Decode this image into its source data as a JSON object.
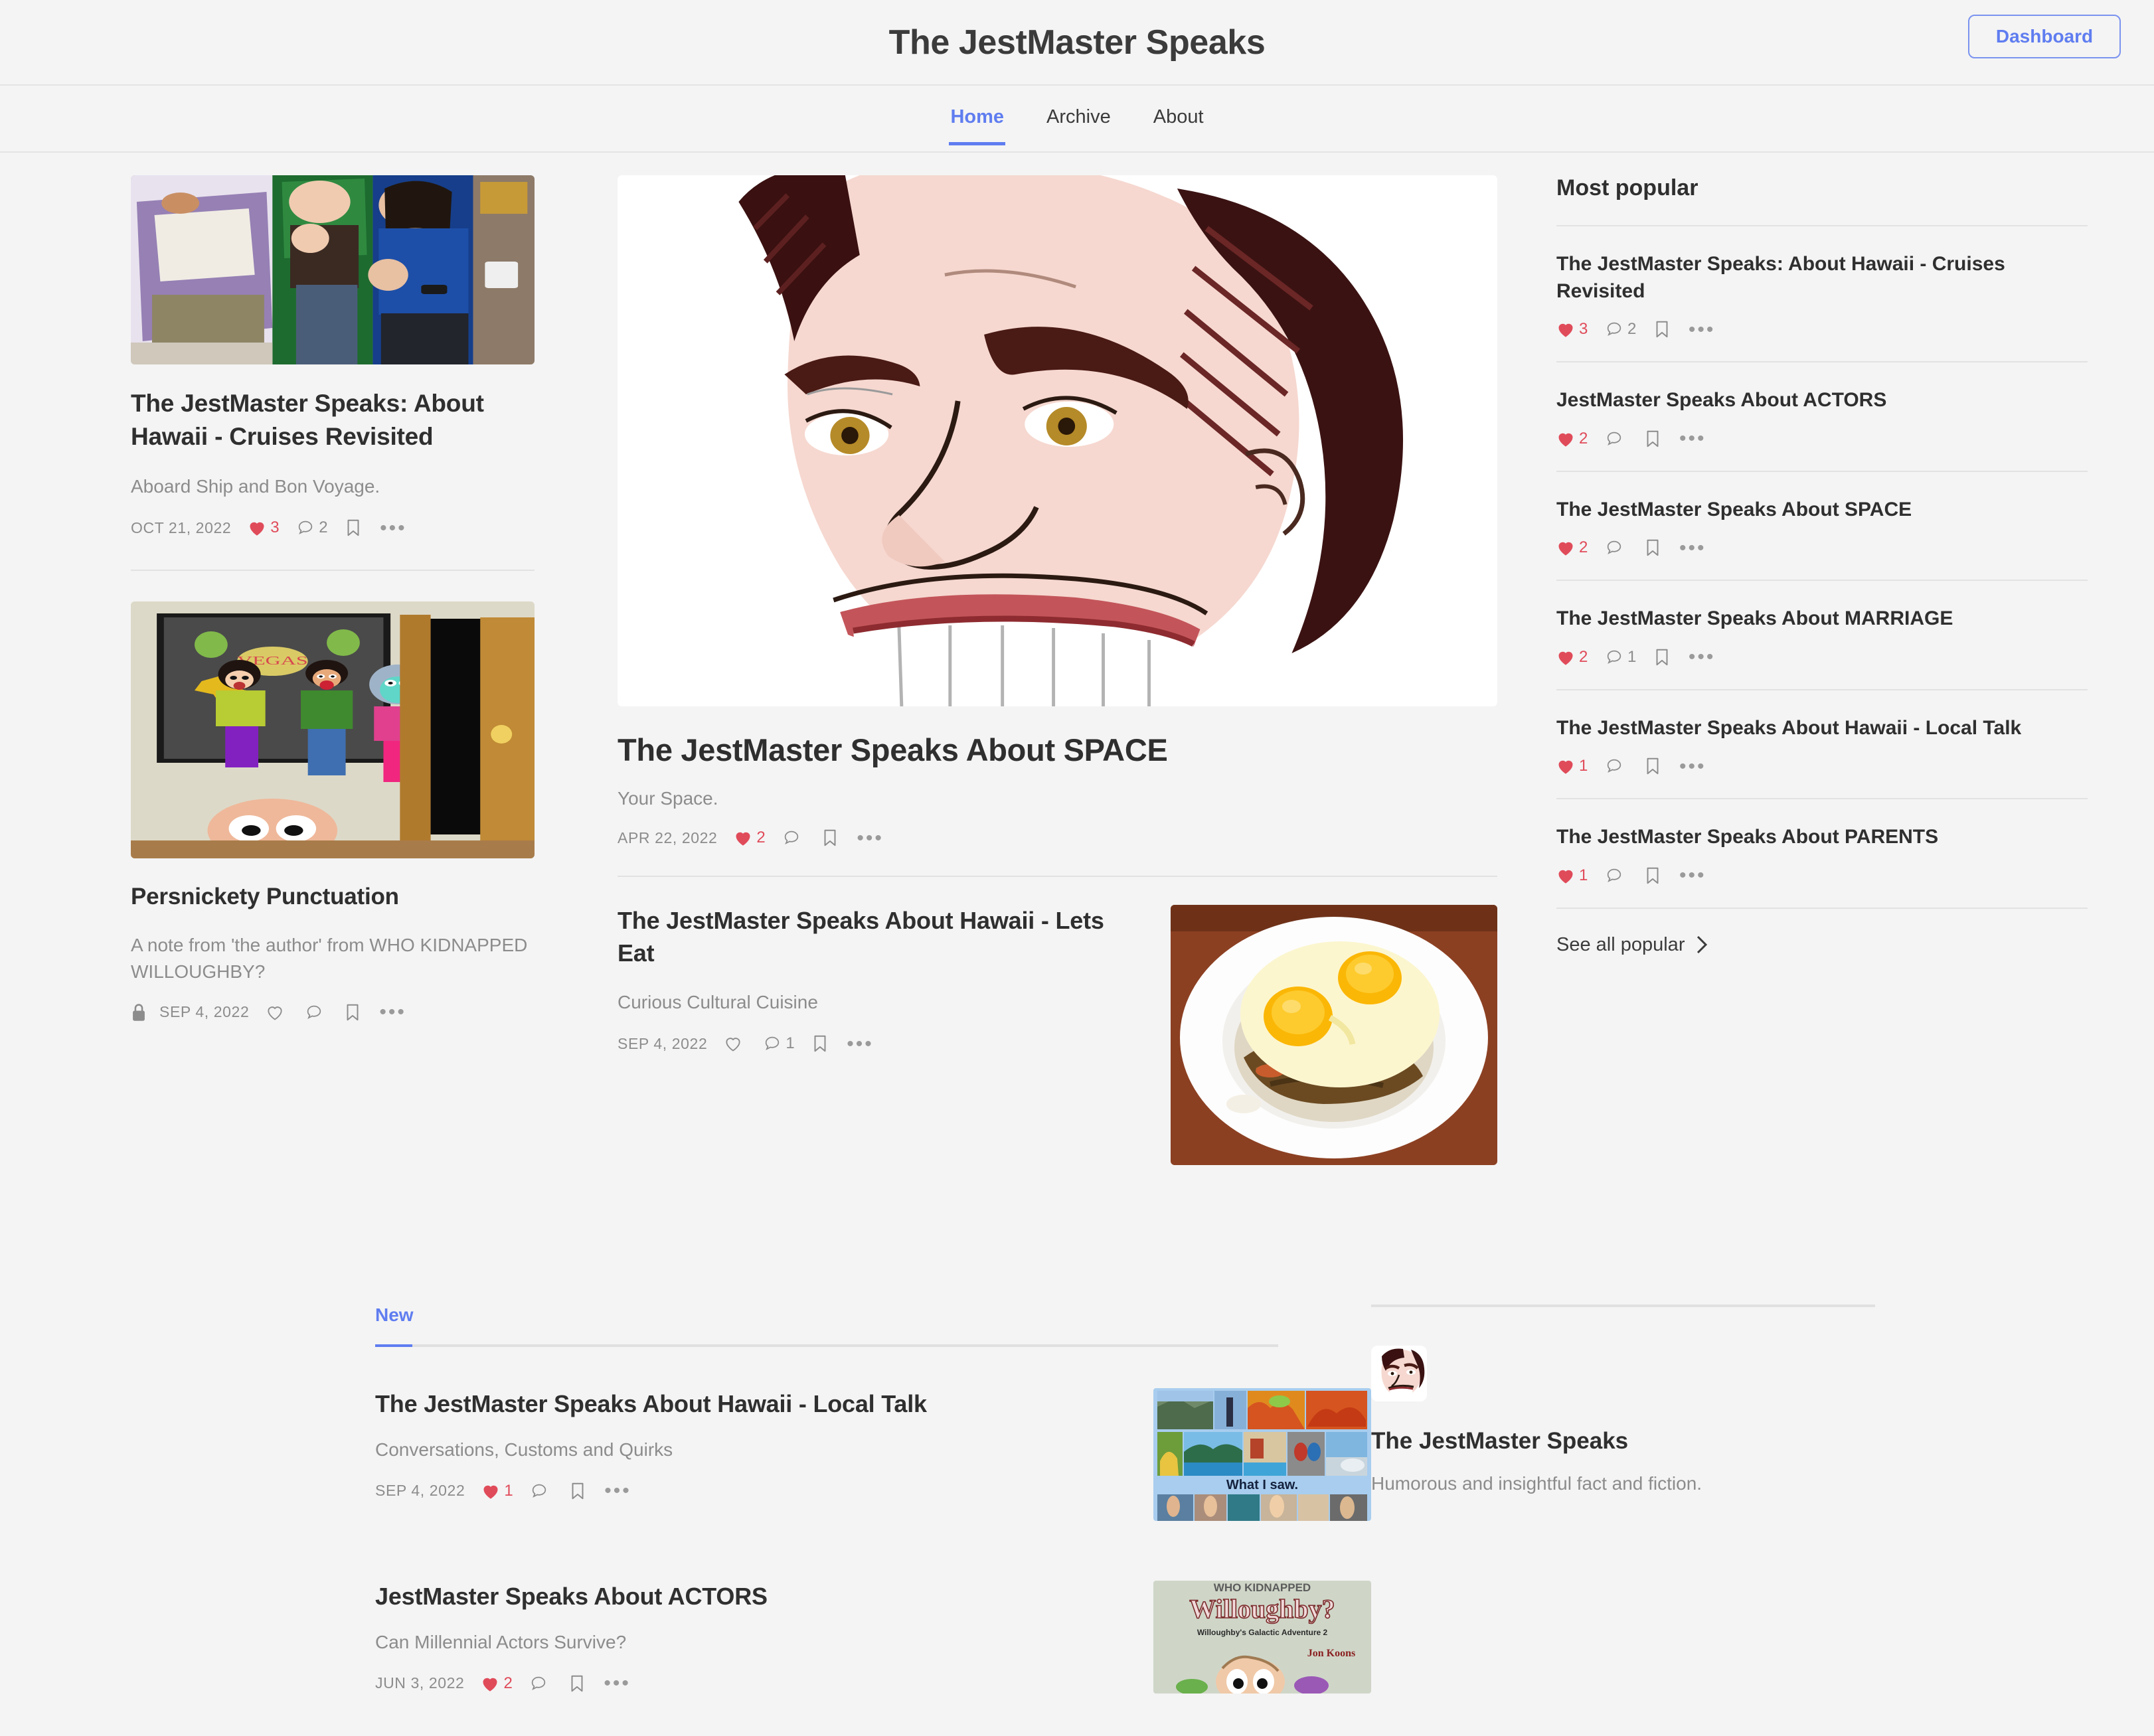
{
  "header": {
    "site_title": "The JestMaster Speaks",
    "dashboard_label": "Dashboard"
  },
  "nav": {
    "items": [
      {
        "label": "Home",
        "active": true
      },
      {
        "label": "Archive",
        "active": false
      },
      {
        "label": "About",
        "active": false
      }
    ]
  },
  "left_column": {
    "cards": [
      {
        "image_alt": "three-people-shaka-hands-photo",
        "title": "The JestMaster Speaks: About Hawaii - Cruises Revisited",
        "subtitle": "Aboard Ship and Bon Voyage.",
        "date": "OCT 21, 2022",
        "likes": "3",
        "comments": "2",
        "locked": false
      },
      {
        "image_alt": "cartoon-las-vegas-doorway-illustration",
        "title": "Persnickety Punctuation",
        "subtitle": "A note from 'the author' from WHO KIDNAPPED WILLOUGHBY?",
        "date": "SEP 4, 2022",
        "likes": "",
        "comments": "",
        "locked": true
      }
    ]
  },
  "middle_column": {
    "featured": {
      "image_alt": "caricature-smiling-man-face",
      "title": "The JestMaster Speaks About SPACE",
      "subtitle": "Your Space.",
      "date": "APR 22, 2022",
      "likes": "2",
      "comments": ""
    },
    "secondary": {
      "title": "The JestMaster Speaks About Hawaii - Lets Eat",
      "subtitle": "Curious Cultural Cuisine",
      "date": "SEP 4, 2022",
      "likes": "",
      "comments": "1",
      "image_alt": "loco-moco-plate-two-fried-eggs"
    }
  },
  "sidebar": {
    "heading": "Most popular",
    "see_all_label": "See all popular",
    "items": [
      {
        "title": "The JestMaster Speaks: About Hawaii - Cruises Revisited",
        "likes": "3",
        "comments": "2"
      },
      {
        "title": "JestMaster Speaks About ACTORS",
        "likes": "2",
        "comments": ""
      },
      {
        "title": "The JestMaster Speaks About SPACE",
        "likes": "2",
        "comments": ""
      },
      {
        "title": "The JestMaster Speaks About MARRIAGE",
        "likes": "2",
        "comments": "1"
      },
      {
        "title": "The JestMaster Speaks About Hawaii - Local Talk",
        "likes": "1",
        "comments": ""
      },
      {
        "title": "The JestMaster Speaks About PARENTS",
        "likes": "1",
        "comments": ""
      }
    ]
  },
  "bottom": {
    "tab_label": "New",
    "posts": [
      {
        "title": "The JestMaster Speaks About Hawaii - Local Talk",
        "subtitle": "Conversations, Customs and Quirks",
        "date": "SEP 4, 2022",
        "likes": "1",
        "comments": "",
        "image_alt": "hawaii-photo-collage-what-i-saw"
      },
      {
        "title": "JestMaster Speaks About ACTORS",
        "subtitle": "Can Millennial Actors Survive?",
        "date": "JUN 3, 2022",
        "likes": "2",
        "comments": "",
        "image_alt": "who-kidnapped-willoughby-book-cover"
      }
    ],
    "author": {
      "name": "The JestMaster Speaks",
      "bio": "Humorous and insightful fact and fiction.",
      "avatar_alt": "caricature-avatar"
    }
  },
  "colors": {
    "accent": "#5f7df0",
    "like_red": "#e04b5a",
    "text": "#2f2f2f",
    "muted": "#8c8c8c",
    "page_bg": "#f4f4f4"
  }
}
